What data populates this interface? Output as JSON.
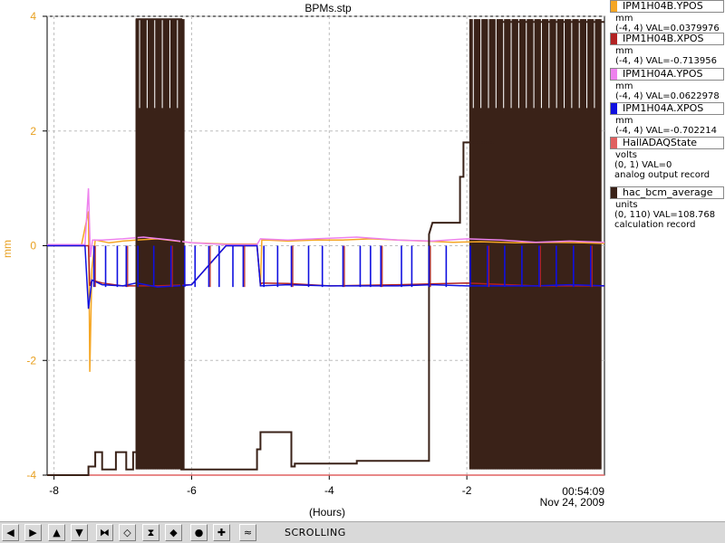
{
  "window": {
    "title": "BPMs.stp"
  },
  "chart_data": {
    "type": "line",
    "title": "BPMs.stp",
    "xlabel": "(Hours)",
    "ylabel": "mm",
    "xlim": [
      -8.1,
      0
    ],
    "ylim": [
      -4,
      4
    ],
    "x_ticks": [
      -8,
      -6,
      -4,
      -2
    ],
    "x_tick_labels": [
      "-8",
      "-6",
      "-4",
      "-2"
    ],
    "y_ticks": [
      -4,
      -2,
      0,
      2,
      4
    ],
    "y_tick_labels": [
      "-4",
      "-2",
      "0",
      "2",
      "4"
    ],
    "end_time": "00:54:09",
    "end_date": "Nov 24, 2009",
    "grid": true,
    "series": [
      {
        "name": "IPM1H04B.YPOS",
        "color": "#f5a623",
        "unit": "mm",
        "range": "(-4, 4)",
        "val": "VAL=0.0379976",
        "x": [
          -8.1,
          -7.6,
          -7.5,
          -7.48,
          -7.45,
          -7.4,
          -7.2,
          -7.0,
          -6.8,
          -6.5,
          -6.0,
          -5.5,
          -5.05,
          -5.0,
          -4.98,
          -4.9,
          -4.6,
          -4.2,
          -3.8,
          -3.4,
          -3.0,
          -2.6,
          -2.2,
          -1.8,
          -1.3,
          -0.8,
          -0.3,
          0
        ],
        "y": [
          0.02,
          0.02,
          0.6,
          -2.2,
          -0.4,
          0.1,
          0.05,
          0.08,
          0.1,
          0.12,
          0.05,
          0.03,
          0.03,
          -0.7,
          0.1,
          0.1,
          0.08,
          0.1,
          0.1,
          0.12,
          0.1,
          0.08,
          0.06,
          0.07,
          0.05,
          0.06,
          0.05,
          0.04
        ]
      },
      {
        "name": "IPM1H04B.XPOS",
        "color": "#b22222",
        "unit": "mm",
        "range": "(-4, 4)",
        "val": "VAL=-0.713956",
        "x": [
          -8.1,
          -7.5,
          -7.48,
          -7.45,
          -7.3,
          -7.0,
          -6.5,
          -6.0,
          -5.5,
          -5.05,
          -5.0,
          -4.98,
          -4.6,
          -4.0,
          -3.0,
          -2.0,
          -1.0,
          0
        ],
        "y": [
          0.0,
          0.0,
          -0.7,
          -0.6,
          -0.65,
          -0.7,
          -0.7,
          -0.68,
          0.0,
          0.0,
          -0.68,
          -0.65,
          -0.66,
          -0.7,
          -0.68,
          -0.65,
          -0.7,
          -0.7
        ]
      },
      {
        "name": "IPM1H04A.YPOS",
        "color": "#ee82ee",
        "unit": "mm",
        "range": "(-4, 4)",
        "val": "VAL=0.0622978",
        "x": [
          -8.1,
          -7.55,
          -7.5,
          -7.47,
          -7.44,
          -7.3,
          -7.0,
          -6.7,
          -6.3,
          -6.0,
          -5.5,
          -5.05,
          -5.0,
          -4.6,
          -4.2,
          -3.6,
          -3.0,
          -2.5,
          -2.0,
          -1.5,
          -1.0,
          -0.5,
          0
        ],
        "y": [
          0.02,
          0.02,
          1.0,
          -0.2,
          0.1,
          0.1,
          0.12,
          0.15,
          0.1,
          0.05,
          0.02,
          0.02,
          0.12,
          0.1,
          0.12,
          0.15,
          0.1,
          0.08,
          0.12,
          0.1,
          0.06,
          0.08,
          0.06
        ]
      },
      {
        "name": "IPM1H04A.XPOS",
        "color": "#1010e0",
        "unit": "mm",
        "range": "(-4, 4)",
        "val": "VAL=-0.702214",
        "x": [
          -8.1,
          -7.55,
          -7.5,
          -7.45,
          -7.3,
          -7.0,
          -6.8,
          -6.5,
          -6.2,
          -6.0,
          -5.5,
          -5.05,
          -5.0,
          -4.6,
          -4.0,
          -3.5,
          -3.0,
          -2.5,
          -2.0,
          -1.5,
          -1.0,
          -0.5,
          0
        ],
        "y": [
          0.0,
          0.0,
          -1.1,
          -0.6,
          -0.68,
          -0.7,
          -0.65,
          -0.72,
          -0.7,
          -0.68,
          0.0,
          0.0,
          -0.7,
          -0.68,
          -0.7,
          -0.7,
          -0.7,
          -0.68,
          -0.7,
          -0.7,
          -0.7,
          -0.68,
          -0.7
        ]
      },
      {
        "name": "HallADAQState",
        "color": "#e06060",
        "unit": "volts",
        "range": "(0, 1)",
        "val": "VAL=0",
        "extra": "analog output record",
        "x": [
          -8.1,
          0
        ],
        "y": [
          -4,
          -4
        ]
      },
      {
        "name": "hac_bcm_average",
        "color": "#3a2218",
        "unit": "units",
        "range": "(0, 110)",
        "val": "VAL=108.768",
        "extra": "calculation record",
        "x": [
          -8.1,
          -7.5,
          -7.5,
          -7.4,
          -7.4,
          -7.3,
          -7.3,
          -7.1,
          -7.1,
          -6.95,
          -6.95,
          -6.85,
          -6.85,
          -6.8,
          -6.8,
          -6.15,
          -6.15,
          -5.05,
          -5.05,
          -5.0,
          -5.0,
          -4.55,
          -4.55,
          -4.5,
          -4.5,
          -3.6,
          -3.6,
          -2.55,
          -2.55,
          -2.5,
          -2.5,
          -2.1,
          -2.1,
          -2.05,
          -2.05,
          -1.6,
          -1.6,
          -1.55,
          -1.55,
          0
        ],
        "y": [
          -4,
          -4,
          -3.85,
          -3.85,
          -3.6,
          -3.6,
          -3.9,
          -3.9,
          -3.6,
          -3.6,
          -3.9,
          -3.9,
          -3.6,
          -3.6,
          3.95,
          3.95,
          -3.9,
          -3.9,
          -3.55,
          -3.55,
          -3.25,
          -3.25,
          -3.85,
          -3.85,
          -3.8,
          -3.8,
          -3.75,
          -3.75,
          0.2,
          0.4,
          0.4,
          0.4,
          1.2,
          1.2,
          1.8,
          1.8,
          2.3,
          2.3,
          3.9,
          3.9
        ]
      }
    ],
    "bursts": {
      "x_from": [
        -6.8,
        -1.95
      ],
      "x_to": [
        -6.1,
        -0.05
      ]
    },
    "spikes": {
      "x": [
        -7.42,
        -7.25,
        -7.08,
        -6.95,
        -6.78,
        -6.55,
        -6.3,
        -6.1,
        -5.95,
        -5.75,
        -5.6,
        -5.4,
        -5.25,
        -4.95,
        -4.75,
        -4.55,
        -4.3,
        -4.1,
        -3.8,
        -3.55,
        -3.4,
        -3.25,
        -2.95,
        -2.8,
        -2.55,
        -2.3,
        -1.95,
        -1.7,
        -1.45,
        -1.2,
        -0.95,
        -0.7,
        -0.45,
        -0.2
      ],
      "y_low": -0.72,
      "y_high": 0.0
    }
  },
  "toolbar": {
    "status": "SCROLLING",
    "buttons": [
      {
        "name": "scroll-left-button",
        "glyph": "◀"
      },
      {
        "name": "scroll-right-button",
        "glyph": "▶"
      },
      {
        "name": "scroll-up-button",
        "glyph": "▲"
      },
      {
        "name": "scroll-down-button",
        "glyph": "▼"
      },
      {
        "name": "zoom-in-horizontal-button",
        "glyph": "⧓"
      },
      {
        "name": "zoom-out-horizontal-button",
        "glyph": "◇"
      },
      {
        "name": "zoom-in-vertical-button",
        "glyph": "⧗"
      },
      {
        "name": "zoom-out-vertical-button",
        "glyph": "◆"
      },
      {
        "name": "autoscale-button",
        "glyph": "●"
      },
      {
        "name": "add-button",
        "glyph": "✚"
      },
      {
        "name": "style-button",
        "glyph": "≈"
      }
    ]
  }
}
